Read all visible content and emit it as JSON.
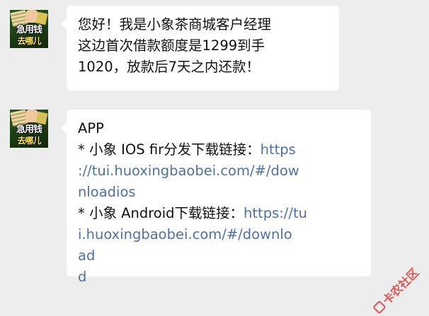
{
  "messages": [
    {
      "avatar": {
        "caption_top": "急用钱",
        "caption_bottom": "去哪儿"
      },
      "lines": [
        "您好！我是小象茶商城客户经理",
        "这边首次借款额度是1299到手",
        "1020，放款后7天之内还款！"
      ]
    },
    {
      "avatar": {
        "caption_top": "急用钱",
        "caption_bottom": "去哪儿"
      },
      "title": "APP",
      "ios_label": "* 小象 IOS fir分发下载链接：",
      "ios_link_parts": [
        "https",
        "://tui.huoxingbaobei.com/#/dow",
        "nloadios"
      ],
      "android_label": "* 小象 Android下载链接：",
      "android_link_parts": [
        "https://tu",
        "i.huoxingbaobei.com/#/downlo",
        "ad",
        "d"
      ]
    }
  ],
  "watermark": {
    "text": "卡农社区"
  },
  "colors": {
    "link": "#4e70a8",
    "watermark": "#e23a3a",
    "background": "#ededed"
  }
}
